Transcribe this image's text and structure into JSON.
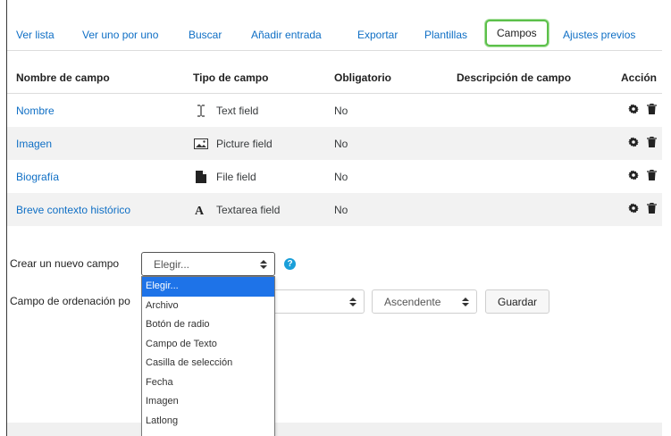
{
  "tabs": [
    {
      "label": "Ver lista"
    },
    {
      "label": "Ver uno por uno"
    },
    {
      "label": "Buscar"
    },
    {
      "label": "Añadir entrada"
    },
    {
      "label": "Exportar"
    },
    {
      "label": "Plantillas"
    },
    {
      "label": "Campos",
      "active": true
    },
    {
      "label": "Ajustes previos"
    }
  ],
  "table": {
    "headers": [
      "Nombre de campo",
      "Tipo de campo",
      "Obligatorio",
      "Descripción de campo",
      "Acción"
    ],
    "rows": [
      {
        "name": "Nombre",
        "type": "Text field",
        "type_icon": "text-cursor-icon",
        "required": "No",
        "description": ""
      },
      {
        "name": "Imagen",
        "type": "Picture field",
        "type_icon": "picture-icon",
        "required": "No",
        "description": ""
      },
      {
        "name": "Biografía",
        "type": "File field",
        "type_icon": "file-icon",
        "required": "No",
        "description": ""
      },
      {
        "name": "Breve contexto histórico",
        "type": "Textarea field",
        "type_icon": "textarea-icon",
        "required": "No",
        "description": ""
      }
    ],
    "action_icons": [
      "gear-icon",
      "trash-icon"
    ]
  },
  "new_field": {
    "label": "Crear un nuevo campo",
    "select_value": "Elegir...",
    "help_icon": "help-icon",
    "options": [
      "Elegir...",
      "Archivo",
      "Botón de radio",
      "Campo de Texto",
      "Casilla de selección",
      "Fecha",
      "Imagen",
      "Latlong"
    ]
  },
  "sort": {
    "label": "Campo de ordenación po",
    "order_value": "Ascendente",
    "save_label": "Guardar"
  },
  "colors": {
    "link": "#0f6fc5",
    "active_tab_border": "#5cc04a",
    "selected_option": "#1e73e8",
    "help": "#1a9fd9"
  }
}
